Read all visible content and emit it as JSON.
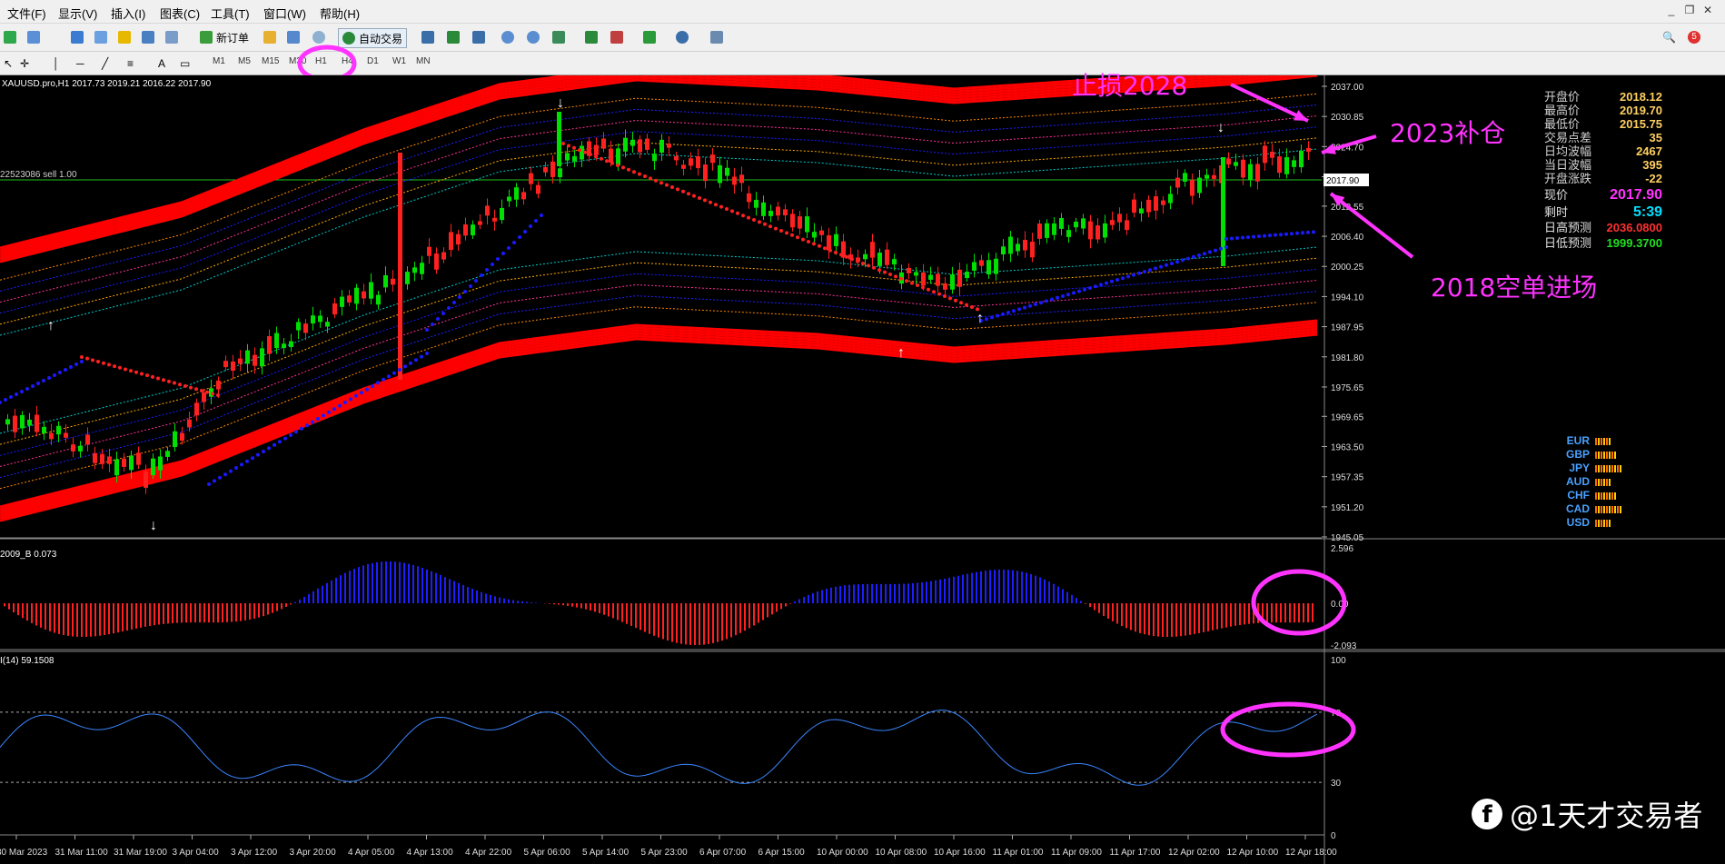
{
  "menu": {
    "items": [
      "文件(F)",
      "显示(V)",
      "插入(I)",
      "图表(C)",
      "工具(T)",
      "窗口(W)",
      "帮助(H)"
    ]
  },
  "toolbar": {
    "new_order": "新订单",
    "auto_trade": "自动交易",
    "notif_count": "5"
  },
  "timeframes": [
    "M1",
    "M5",
    "M15",
    "M30",
    "H1",
    "H4",
    "D1",
    "W1",
    "MN"
  ],
  "chart": {
    "header": "XAUUSD.pro,H1  2017.73 2019.21 2016.22 2017.90",
    "order_label": "22523086 sell 1.00",
    "current_price": "2017.90",
    "y_ticks": [
      "2037.00",
      "2030.85",
      "2024.70",
      "2018.55",
      "2012.55",
      "2006.40",
      "2000.25",
      "1994.10",
      "1987.95",
      "1981.80",
      "1975.65",
      "1969.65",
      "1963.50",
      "1957.35",
      "1951.20",
      "1945.05"
    ],
    "x_ticks": [
      "30 Mar 2023",
      "31 Mar 11:00",
      "31 Mar 19:00",
      "3 Apr 04:00",
      "3 Apr 12:00",
      "3 Apr 20:00",
      "4 Apr 05:00",
      "4 Apr 13:00",
      "4 Apr 22:00",
      "5 Apr 06:00",
      "5 Apr 14:00",
      "5 Apr 23:00",
      "6 Apr 07:00",
      "6 Apr 15:00",
      "10 Apr 00:00",
      "10 Apr 08:00",
      "10 Apr 16:00",
      "11 Apr 01:00",
      "11 Apr 09:00",
      "11 Apr 17:00",
      "12 Apr 02:00",
      "12 Apr 10:00",
      "12 Apr 18:00"
    ]
  },
  "info_panel": {
    "rows": [
      {
        "label": "开盘价",
        "value": "2018.12",
        "color": "#ffd060"
      },
      {
        "label": "最高价",
        "value": "2019.70",
        "color": "#ffd060"
      },
      {
        "label": "最低价",
        "value": "2015.75",
        "color": "#ffd060"
      },
      {
        "label": "交易点差",
        "value": "35",
        "color": "#ffd060"
      },
      {
        "label": "日均波幅",
        "value": "2467",
        "color": "#ffd060"
      },
      {
        "label": "当日波幅",
        "value": "395",
        "color": "#ffd060"
      },
      {
        "label": "开盘涨跌",
        "value": "-22",
        "color": "#ffd060"
      }
    ],
    "price_label": "现价",
    "price": "2017.90",
    "time_label": "剩时",
    "time": "5:39",
    "high_label": "日高预测",
    "high": "2036.0800",
    "low_label": "日低预测",
    "low": "1999.3700"
  },
  "currencies": [
    "EUR",
    "GBP",
    "JPY",
    "AUD",
    "CHF",
    "CAD",
    "USD"
  ],
  "macd": {
    "header": "2009_B 0.073",
    "ticks": [
      "2.596",
      "0.00",
      "-2.093"
    ]
  },
  "rsi": {
    "header": "I(14) 59.1508",
    "ticks": [
      "100",
      "70",
      "30",
      "0"
    ]
  },
  "annotations": {
    "stop_loss": "止损2028",
    "add_position": "2023补仓",
    "short_entry": "2018空单进场"
  },
  "watermark": "@1天才交易者",
  "colors": {
    "bull": "#00e000",
    "bear": "#ff2020",
    "band": "#ff0000",
    "annotation": "#ff33ff",
    "rsi": "#3a86ff",
    "macd_up": "#1e1eff",
    "macd_down": "#ff2020"
  }
}
